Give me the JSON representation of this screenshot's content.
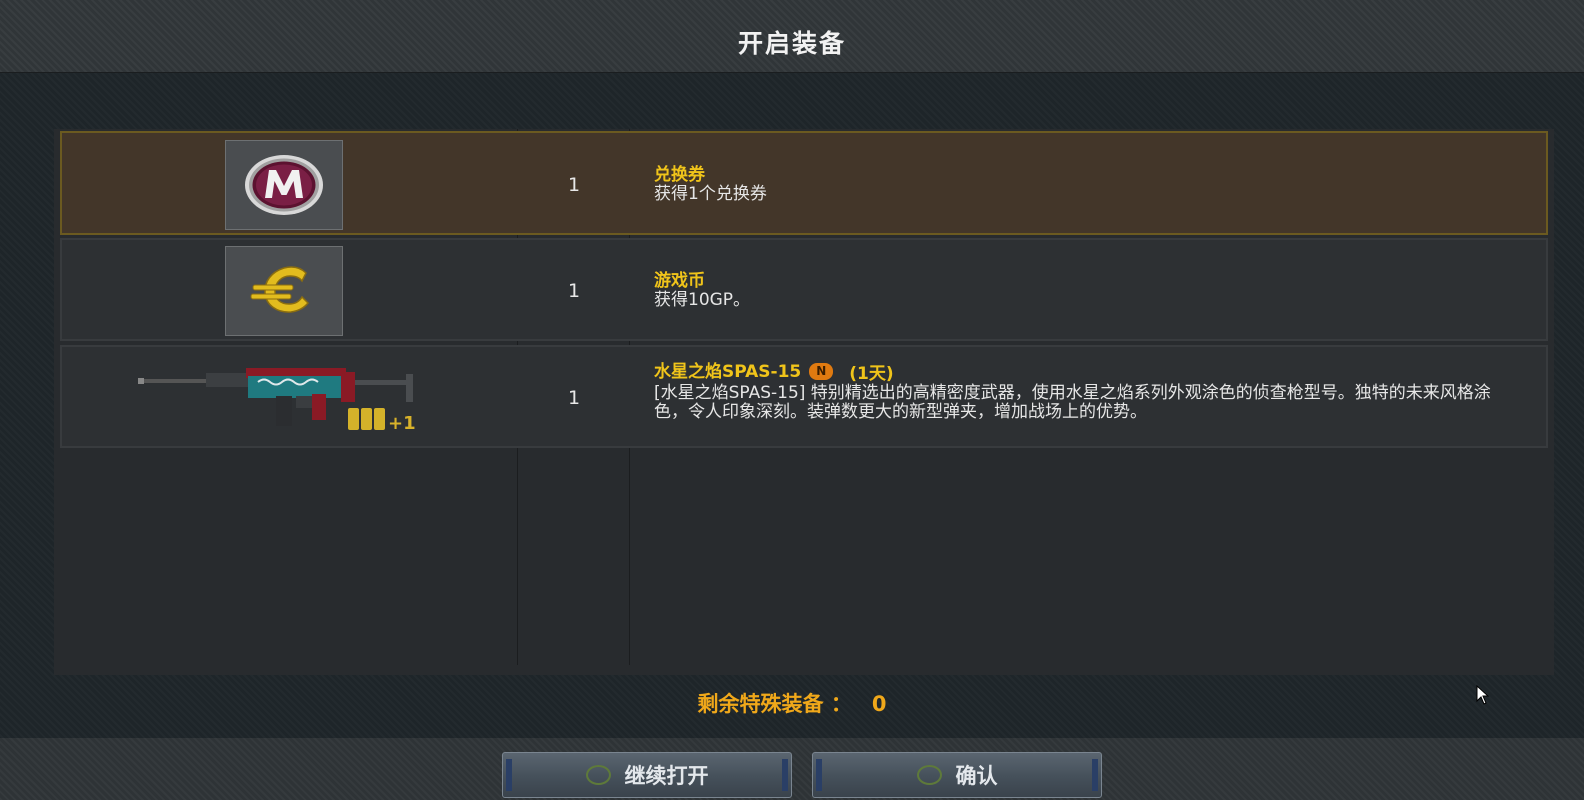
{
  "window": {
    "title": "开启装备"
  },
  "items": [
    {
      "icon": "m-coupon-icon",
      "name": "兑换券",
      "quantity": "1",
      "description": " 获得1个兑换券",
      "selected": true
    },
    {
      "icon": "euro-coin-icon",
      "name": "游戏币",
      "quantity": "1",
      "description": " 获得10GP。",
      "selected": false
    },
    {
      "icon": "shotgun-icon",
      "name": "水星之焰SPAS-15",
      "badge": "N",
      "duration": "(1天)",
      "quantity": "1",
      "ammo_label": "+1",
      "description": "[水星之焰SPAS-15] 特别精选出的高精密度武器，使用水星之焰系列外观涂色的侦查枪型号。独特的未来风格涂色，令人印象深刻。装弹数更大的新型弹夹，增加战场上的优势。",
      "selected": false
    }
  ],
  "footer": {
    "remaining_label": "剩余特殊装备 ：",
    "remaining_count": "0",
    "continue_button": "继续打开",
    "confirm_button": "确认"
  },
  "colors": {
    "accent_gold": "#f0c41a",
    "selected_row": "#433629",
    "remaining_orange": "#f0a81a"
  }
}
